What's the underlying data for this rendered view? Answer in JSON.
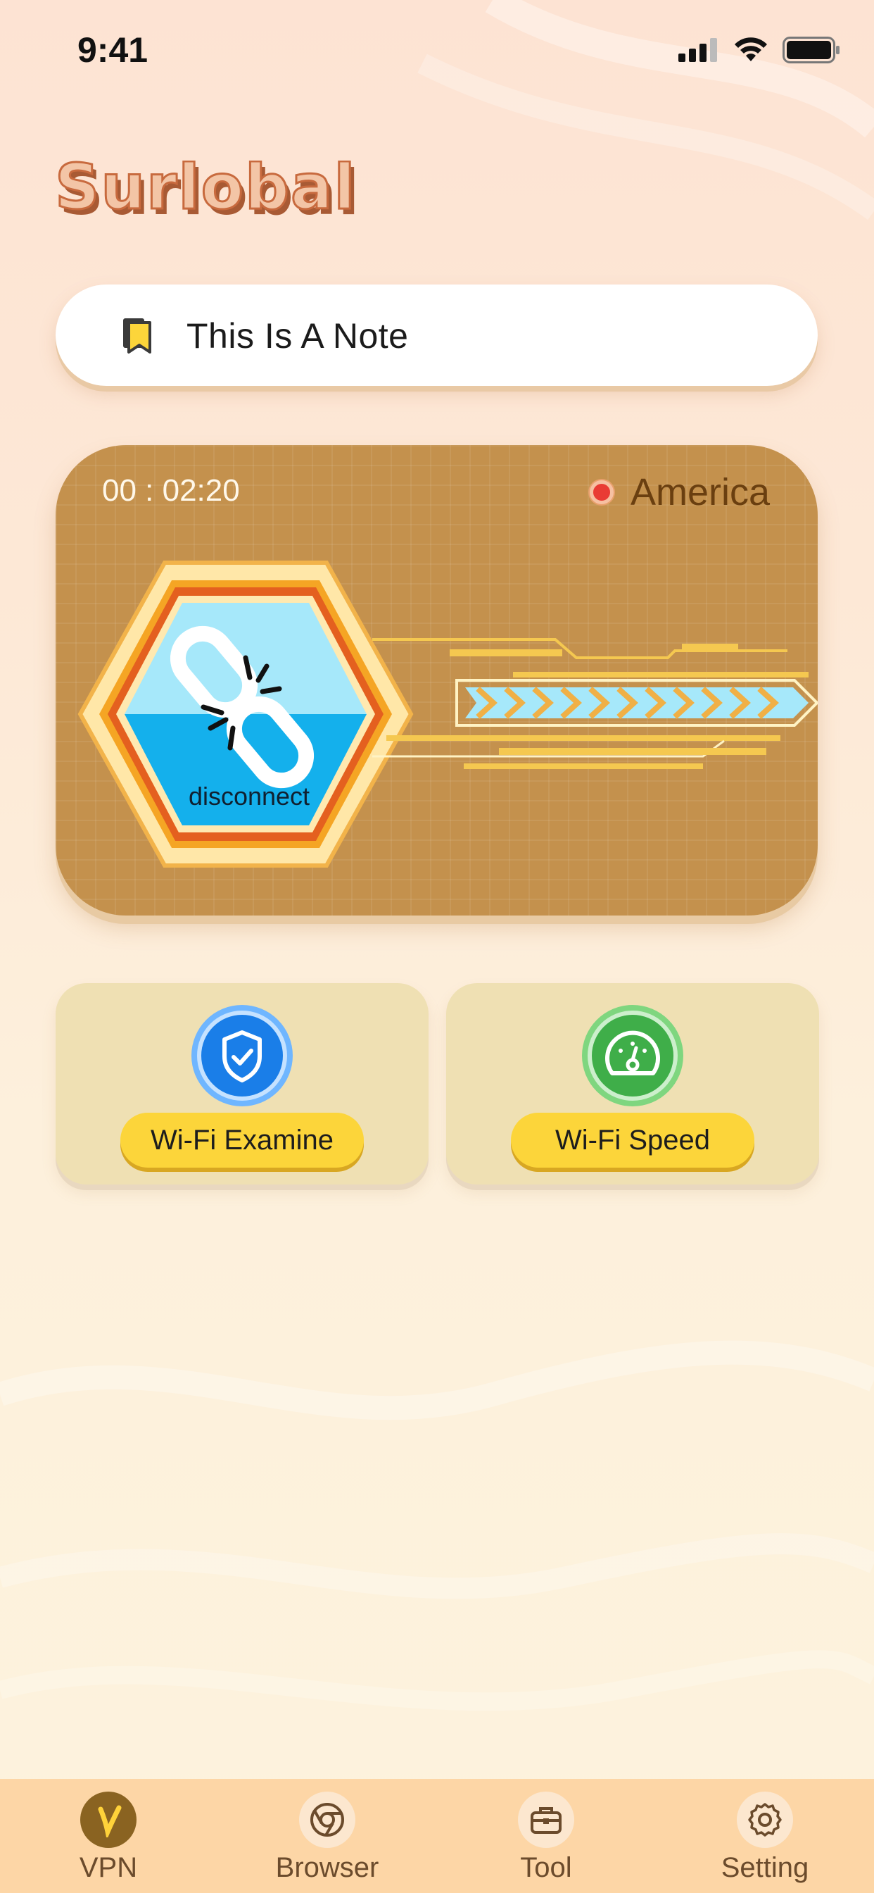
{
  "status_bar": {
    "time": "9:41"
  },
  "app": {
    "logo_text": "Surlobal"
  },
  "note": {
    "text": "This Is A Note",
    "icon": "bookmark-icon"
  },
  "vpn": {
    "timer": "00 : 02:20",
    "location": "America",
    "connect_button_label": "disconnect",
    "status_color": "#e93b34"
  },
  "tools": [
    {
      "label": "Wi-Fi Examine",
      "icon": "shield-check-icon",
      "color": "#1a7ee8"
    },
    {
      "label": "Wi-Fi Speed",
      "icon": "speedometer-icon",
      "color": "#3fae49"
    }
  ],
  "tab_bar": {
    "tabs": [
      {
        "label": "VPN",
        "icon": "vpn-icon",
        "active": true
      },
      {
        "label": "Browser",
        "icon": "browser-icon",
        "active": false
      },
      {
        "label": "Tool",
        "icon": "toolbox-icon",
        "active": false
      },
      {
        "label": "Setting",
        "icon": "gear-icon",
        "active": false
      }
    ]
  },
  "colors": {
    "accent_yellow": "#fcd53a",
    "card_brown": "#c4914d",
    "tab_bar_bg": "#fdd6a6"
  }
}
